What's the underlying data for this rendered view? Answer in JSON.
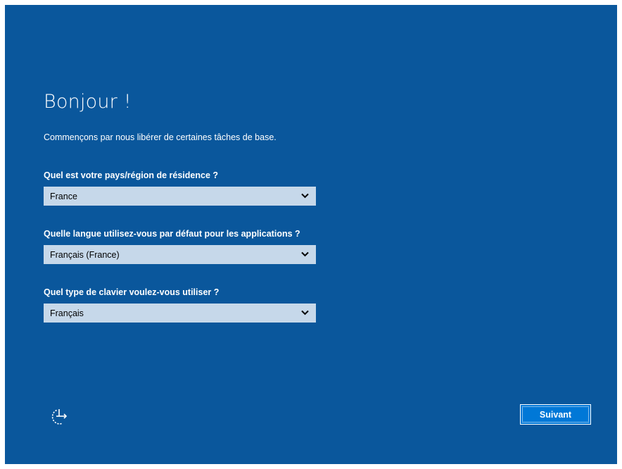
{
  "title": "Bonjour !",
  "subtitle": "Commençons par nous libérer de certaines tâches de base.",
  "questions": [
    {
      "label": "Quel est votre pays/région de résidence ?",
      "selected": "France"
    },
    {
      "label": "Quelle langue utilisez-vous par défaut pour les applications ?",
      "selected": "Français (France)"
    },
    {
      "label": "Quel type de clavier voulez-vous utiliser ?",
      "selected": "Français"
    }
  ],
  "buttons": {
    "next_label": "Suivant"
  },
  "icons": {
    "accessibility": "ease-of-access-icon",
    "dropdown": "chevron-down-icon"
  },
  "colors": {
    "background": "#0a579c",
    "dropdown_fill": "#c6d8ea",
    "button_fill": "#0078d7",
    "text": "#ffffff"
  }
}
